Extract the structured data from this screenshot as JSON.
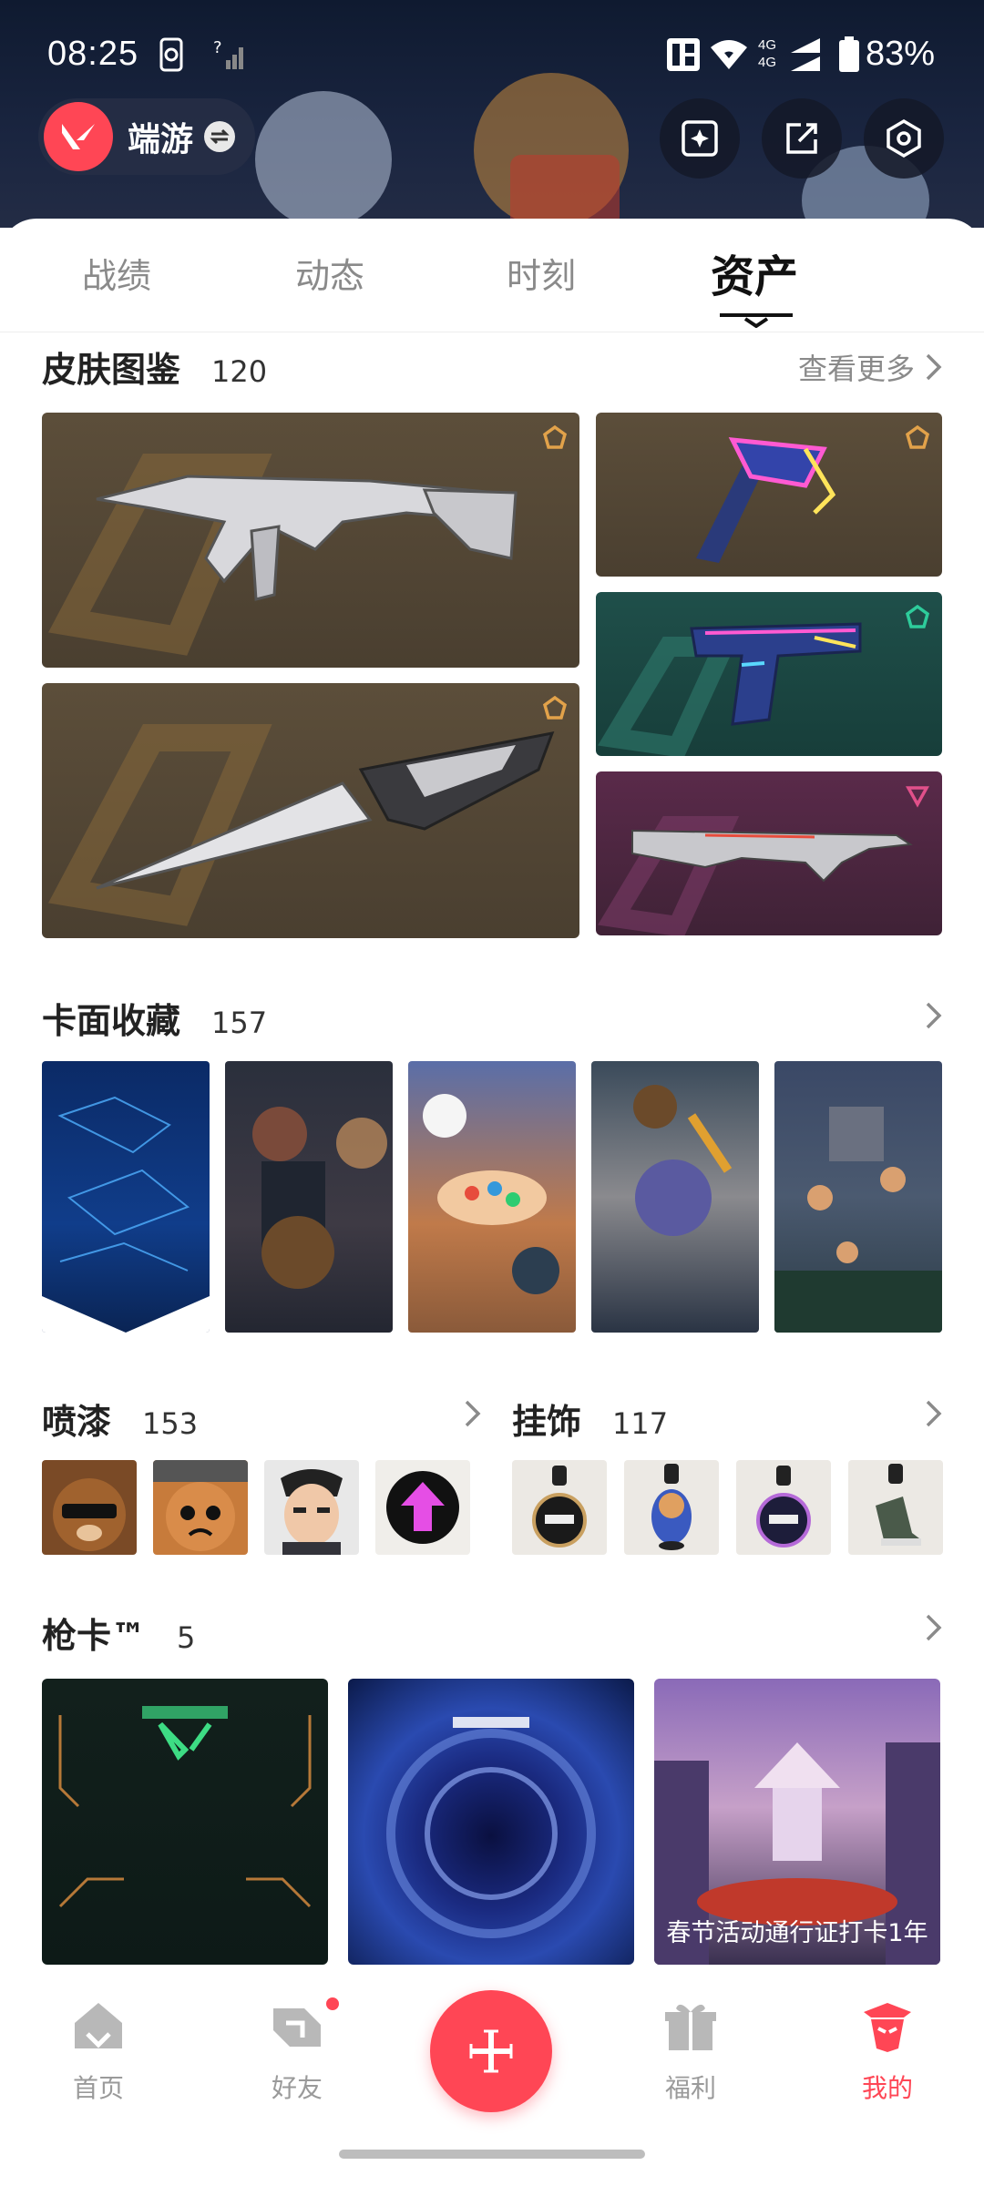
{
  "status_bar": {
    "time": "08:25",
    "battery": "83%",
    "network_label": "4G"
  },
  "account": {
    "name": "端游",
    "logo_icon": "valorant-logo-icon"
  },
  "header_buttons": [
    {
      "name": "edit-card-button",
      "icon": "card-edit-icon"
    },
    {
      "name": "share-button",
      "icon": "share-icon"
    },
    {
      "name": "settings-button",
      "icon": "settings-hex-icon"
    }
  ],
  "tabs": [
    {
      "label": "战绩",
      "active": false
    },
    {
      "label": "动态",
      "active": false
    },
    {
      "label": "时刻",
      "active": false
    },
    {
      "label": "资产",
      "active": true
    }
  ],
  "skins": {
    "title": "皮肤图鉴",
    "count": "120",
    "more_label": "查看更多",
    "items": [
      {
        "name": "rifle-skin",
        "rarity_color": "#e2a24a"
      },
      {
        "name": "axe-skin",
        "rarity_color": "#e2a24a"
      },
      {
        "name": "pistol-skin",
        "rarity_color": "#2ecc9b"
      },
      {
        "name": "knife-skin",
        "rarity_color": "#e2a24a"
      },
      {
        "name": "vandal-skin",
        "rarity_color": "#e0508a"
      }
    ]
  },
  "cards": {
    "title": "卡面收藏",
    "count": "157"
  },
  "sprays": {
    "title": "喷漆",
    "count": "153"
  },
  "gunbuddies": {
    "title": "挂饰",
    "count": "117"
  },
  "banners": {
    "title": "枪卡™",
    "count": "5",
    "items": [
      {
        "caption": ""
      },
      {
        "caption": ""
      },
      {
        "caption": "春节活动通行证打卡1年"
      }
    ]
  },
  "bottom_nav": [
    {
      "label": "首页",
      "active": false
    },
    {
      "label": "好友",
      "active": false,
      "badge": true
    },
    {
      "label": "福利",
      "active": false
    },
    {
      "label": "我的",
      "active": true
    }
  ],
  "colors": {
    "accent": "#ff4655",
    "inactive": "#9a9a9a"
  }
}
